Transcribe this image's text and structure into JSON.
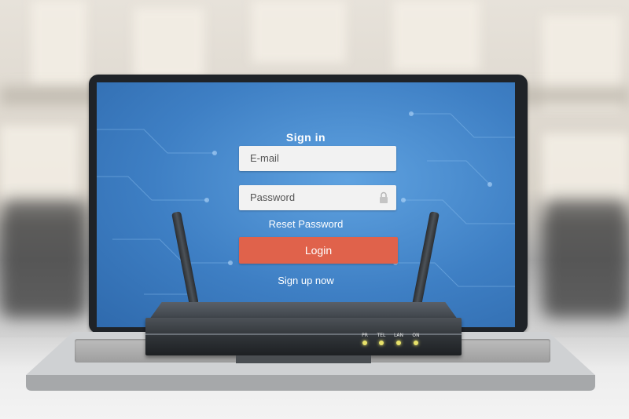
{
  "login": {
    "title": "Sign in",
    "email_placeholder": "E-mail",
    "password_placeholder": "Password",
    "reset_link": "Reset Password",
    "login_button": "Login",
    "signup_link": "Sign up now"
  },
  "router": {
    "leds": [
      "PR",
      "TEL",
      "LAN",
      "ON"
    ]
  },
  "colors": {
    "screen_blue": "#3e7fc4",
    "login_button": "#e0624b",
    "led": "#e8e26a"
  }
}
